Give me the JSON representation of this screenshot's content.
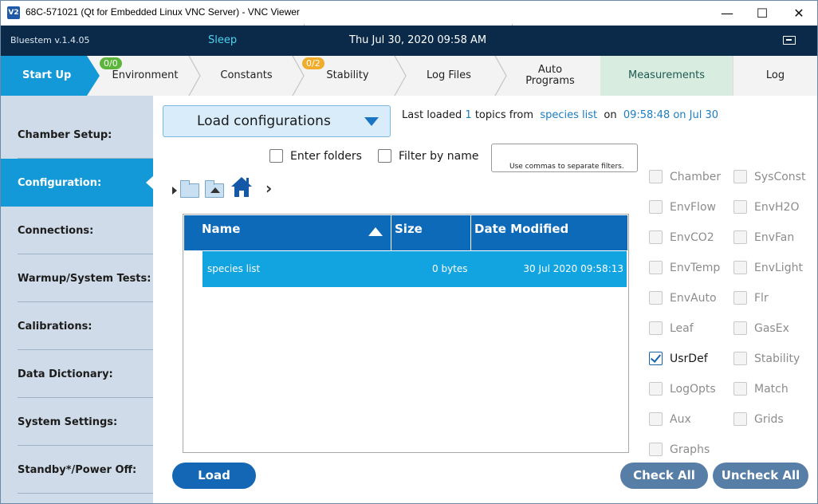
{
  "window": {
    "icon": "V2",
    "title": "68C-571021 (Qt for Embedded Linux VNC Server) - VNC Viewer",
    "minimize": "—",
    "maximize": "☐",
    "close": "✕"
  },
  "status_bar": {
    "version": "Bluestem v.1.4.05",
    "state": "Sleep",
    "datetime": "Thu Jul 30, 2020 09:58 AM",
    "battery_icon": "battery-icon"
  },
  "tabs": [
    {
      "label": "Start Up",
      "active": true
    },
    {
      "label": "Environment",
      "badge": "0/0",
      "badge_color": "#5cb53b"
    },
    {
      "label": "Constants"
    },
    {
      "label": "Stability",
      "badge": "0/2",
      "badge_color": "#f0ac2a"
    },
    {
      "label": "Log Files"
    },
    {
      "label": "Auto Programs"
    },
    {
      "label": "Measurements"
    },
    {
      "label": "Log"
    }
  ],
  "sidenav": [
    {
      "label": "Chamber Setup:"
    },
    {
      "label": "Configuration:",
      "active": true
    },
    {
      "label": "Connections:"
    },
    {
      "label": "Warmup/System Tests:"
    },
    {
      "label": "Calibrations:"
    },
    {
      "label": "Data Dictionary:"
    },
    {
      "label": "System Settings:"
    },
    {
      "label": "Standby*/Power Off:"
    }
  ],
  "main": {
    "load_config_label": "Load configurations",
    "last_loaded": {
      "prefix": "Last loaded",
      "count": "1",
      "middle": "topics from",
      "source": "species list",
      "on": "on",
      "time": "09:58:48 on Jul 30"
    },
    "enter_folders_label": "Enter folders",
    "filter_by_name_label": "Filter by name",
    "filter_placeholder": "Use commas to separate filters.",
    "table": {
      "headers": {
        "name": "Name",
        "size": "Size",
        "date": "Date Modified"
      },
      "rows": [
        {
          "name": "species list",
          "size": "0 bytes",
          "date": "30 Jul 2020 09:58:13"
        }
      ]
    },
    "load_button": "Load",
    "check_all_button": "Check All",
    "uncheck_all_button": "Uncheck All"
  },
  "topics_left": [
    {
      "label": "Chamber",
      "checked": false
    },
    {
      "label": "EnvFlow",
      "checked": false
    },
    {
      "label": "EnvCO2",
      "checked": false
    },
    {
      "label": "EnvTemp",
      "checked": false
    },
    {
      "label": "EnvAuto",
      "checked": false
    },
    {
      "label": "Leaf",
      "checked": false
    },
    {
      "label": "UsrDef",
      "checked": true
    },
    {
      "label": "LogOpts",
      "checked": false
    },
    {
      "label": "Aux",
      "checked": false
    },
    {
      "label": "Graphs",
      "checked": false
    }
  ],
  "topics_right": [
    {
      "label": "SysConst",
      "checked": false
    },
    {
      "label": "EnvH2O",
      "checked": false
    },
    {
      "label": "EnvFan",
      "checked": false
    },
    {
      "label": "EnvLight",
      "checked": false
    },
    {
      "label": "Flr",
      "checked": false
    },
    {
      "label": "GasEx",
      "checked": false
    },
    {
      "label": "Stability",
      "checked": false
    },
    {
      "label": "Match",
      "checked": false
    },
    {
      "label": "Grids",
      "checked": false
    }
  ],
  "colors": {
    "accent": "#1499d8",
    "header_dark": "#0b2a4a",
    "table_header": "#0d6ab8",
    "selection": "#12a4e0",
    "button_primary": "#1467b4",
    "button_secondary": "#577ea6"
  }
}
